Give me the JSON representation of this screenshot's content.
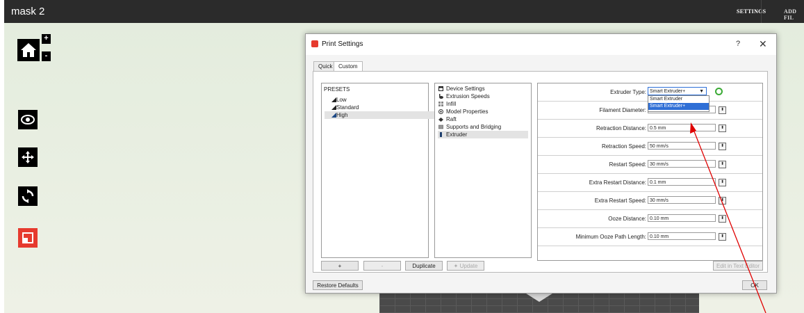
{
  "app": {
    "title": "mask 2",
    "nav": [
      "SETTINGS",
      "ADD FIL"
    ]
  },
  "left_toolbar": {
    "zoom_in": "+",
    "zoom_out": "-",
    "icons": [
      "home-icon",
      "zoom-in-icon",
      "zoom-out-icon",
      "eye-icon",
      "move-icon",
      "rotate-icon",
      "scale-icon"
    ]
  },
  "dialog": {
    "title": "Print Settings",
    "help": "?",
    "close": "✕",
    "tabs": [
      "Quick",
      "Custom"
    ],
    "active_tab": "Custom",
    "presets": {
      "header": "PRESETS",
      "items": [
        "Low",
        "Standard",
        "High"
      ],
      "selected": "High"
    },
    "categories": {
      "items": [
        "Device Settings",
        "Extrusion Speeds",
        "Infill",
        "Model Properties",
        "Raft",
        "Supports and Bridging",
        "Extruder"
      ],
      "selected": "Extruder"
    },
    "extruder_type": {
      "label": "Extruder Type:",
      "value": "Smart Extruder+",
      "options": [
        "Smart Extruder",
        "Smart Extruder+"
      ],
      "highlighted_option": "Smart Extruder+"
    },
    "fields": [
      {
        "label": "Filament Diameter:",
        "value": ""
      },
      {
        "label": "Retraction Distance:",
        "value": "0.5 mm"
      },
      {
        "label": "Retraction Speed:",
        "value": "50 mm/s"
      },
      {
        "label": "Restart Speed:",
        "value": "30 mm/s"
      },
      {
        "label": "Extra Restart Distance:",
        "value": "0.1 mm"
      },
      {
        "label": "Extra Restart Speed:",
        "value": "30 mm/s"
      },
      {
        "label": "Ooze Distance:",
        "value": "0.10 mm"
      },
      {
        "label": "Minimum Ooze Path Length:",
        "value": "0.10 mm"
      }
    ],
    "buttons": {
      "add": "+",
      "remove": "-",
      "duplicate": "Duplicate",
      "update": "Update",
      "edit_text": "Edit in Text Editor",
      "restore": "Restore Defaults",
      "ok": "OK"
    }
  },
  "colors": {
    "accent_red": "#e63a2e",
    "selection_blue": "#2f6fd6",
    "annotation_arrow": "#e00000"
  }
}
